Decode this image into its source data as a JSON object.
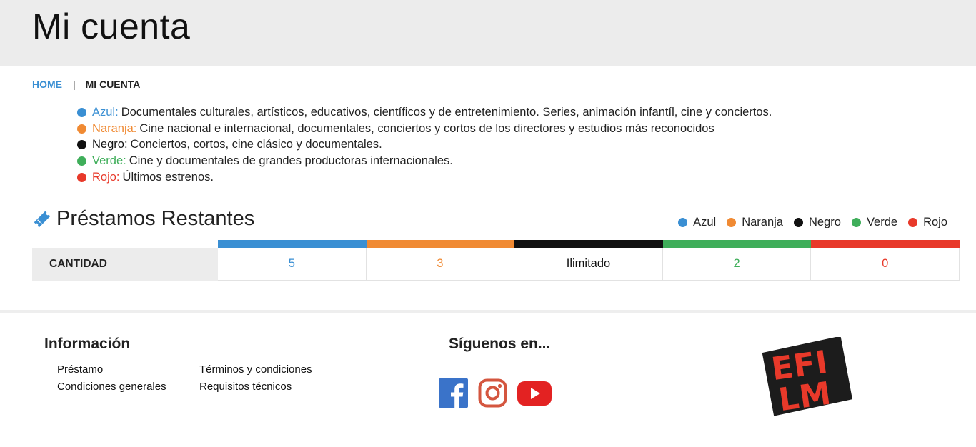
{
  "header": {
    "title": "Mi cuenta"
  },
  "breadcrumb": {
    "home": "HOME",
    "separator": "|",
    "current": "MI CUENTA"
  },
  "categories": [
    {
      "key": "Azul:",
      "description": "Documentales culturales, artísticos, educativos, científicos y de entretenimiento. Series, animación infantíl, cine y conciertos.",
      "color": "#3a8fd3"
    },
    {
      "key": "Naranja:",
      "description": "Cine nacional e internacional, documentales, conciertos y cortos de los directores y estudios más reconocidos",
      "color": "#f08a33"
    },
    {
      "key": "Negro:",
      "description": "Conciertos, cortos, cine clásico y documentales.",
      "color": "#111111"
    },
    {
      "key": "Verde:",
      "description": "Cine y documentales de grandes productoras internacionales.",
      "color": "#3fae5a"
    },
    {
      "key": "Rojo:",
      "description": "Últimos estrenos.",
      "color": "#e8392a"
    }
  ],
  "loans": {
    "title": "Préstamos Restantes",
    "icon": "ticket-icon",
    "legend": [
      {
        "label": "Azul",
        "color": "#3a8fd3"
      },
      {
        "label": "Naranja",
        "color": "#f08a33"
      },
      {
        "label": "Negro",
        "color": "#111111"
      },
      {
        "label": "Verde",
        "color": "#3fae5a"
      },
      {
        "label": "Rojo",
        "color": "#e8392a"
      }
    ],
    "row_label": "CANTIDAD",
    "values": [
      {
        "value": "5",
        "color": "#3a8fd3"
      },
      {
        "value": "3",
        "color": "#f08a33"
      },
      {
        "value": "Ilimitado",
        "color": "#111111"
      },
      {
        "value": "2",
        "color": "#3fae5a"
      },
      {
        "value": "0",
        "color": "#e8392a"
      }
    ]
  },
  "footer": {
    "info_title": "Información",
    "links_col1": [
      "Préstamo",
      "Condiciones generales"
    ],
    "links_col2": [
      "Términos y condiciones",
      "Requisitos técnicos"
    ],
    "social_title": "Síguenos en...",
    "social": [
      {
        "name": "facebook-icon",
        "color": "#3a73c9"
      },
      {
        "name": "instagram-icon",
        "color": "#d4563f"
      },
      {
        "name": "youtube-icon",
        "color": "#e32222"
      }
    ],
    "logo": {
      "line1": "EFI",
      "line2": "LM",
      "color": "#e8392a"
    }
  }
}
